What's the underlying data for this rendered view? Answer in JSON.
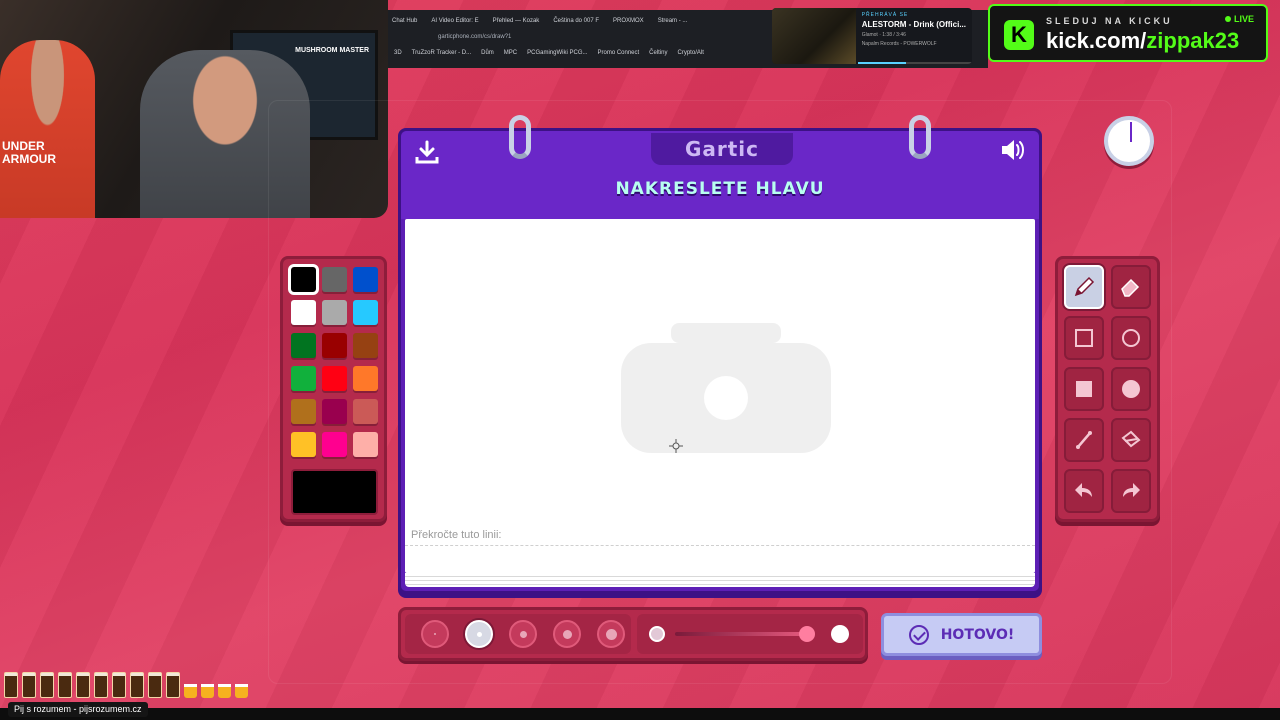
{
  "browser": {
    "tabs": [
      "Chat Hub",
      "AI Video Editor: E",
      "Přehled — Kozak",
      "Čeština do 007 F",
      "PROXMOX",
      "Stream - ..."
    ],
    "url": "garticphone.com/cs/draw?1",
    "bookmarks": [
      "3D",
      "TruZzoR Tracker - D...",
      "Dům",
      "MPC",
      "PCGamingWiki PCG...",
      "Promo Connect",
      "Čeltiny",
      "Crypto/Alt"
    ]
  },
  "now_playing": {
    "label": "PŘEHRÁVÁ SE",
    "title": "ALESTORM - Drink (Offici...",
    "poster": "Glamot",
    "time": "1:38 / 3:46",
    "source": "Napalm Records - POWERWOLF"
  },
  "kick": {
    "subtitle": "SLEDUJ NA KICKU",
    "live": "LIVE",
    "url_prefix": "kick.com/",
    "url_user": "zippak23",
    "logo_letter": "K",
    "brand_color": "#53fc18"
  },
  "webcam": {
    "monitor_title": "MUSHROOM MASTER",
    "shirt_text": "UNDER ARMOUR"
  },
  "game": {
    "logo": "Gartic",
    "prompt": "NAKRESLETE HLAVU",
    "line_label": "Překročte tuto linii:",
    "done_label": "HOTOVO!",
    "download_icon": "download-icon",
    "sound_icon": "speaker-icon"
  },
  "palette": {
    "colors": [
      "#000000",
      "#666666",
      "#0050cd",
      "#ffffff",
      "#aaaaaa",
      "#26c9ff",
      "#017420",
      "#990000",
      "#964112",
      "#11b03c",
      "#ff0013",
      "#ff7829",
      "#b0701c",
      "#99004e",
      "#cb5a57",
      "#ffc126",
      "#ff008f",
      "#feafa8"
    ],
    "selected_index": 0,
    "current_color": "#000000"
  },
  "tools": [
    {
      "name": "pencil",
      "icon": "pencil-icon",
      "active": true
    },
    {
      "name": "eraser",
      "icon": "eraser-icon",
      "active": false
    },
    {
      "name": "rectangle-outline",
      "icon": "square-outline-icon",
      "active": false
    },
    {
      "name": "ellipse-outline",
      "icon": "circle-outline-icon",
      "active": false
    },
    {
      "name": "rectangle-filled",
      "icon": "square-filled-icon",
      "active": false
    },
    {
      "name": "ellipse-filled",
      "icon": "circle-filled-icon",
      "active": false
    },
    {
      "name": "line",
      "icon": "line-icon",
      "active": false
    },
    {
      "name": "fill",
      "icon": "bucket-icon",
      "active": false
    },
    {
      "name": "undo",
      "icon": "undo-icon",
      "active": false
    },
    {
      "name": "redo",
      "icon": "redo-icon",
      "active": false
    }
  ],
  "brush_sizes": {
    "count": 5,
    "selected_index": 1
  },
  "opacity": {
    "value": 1.0
  },
  "overlay": {
    "beers_full": 10,
    "beers_empty": 4,
    "sponsor": "Pij s rozumem - pijsrozumem.cz"
  }
}
